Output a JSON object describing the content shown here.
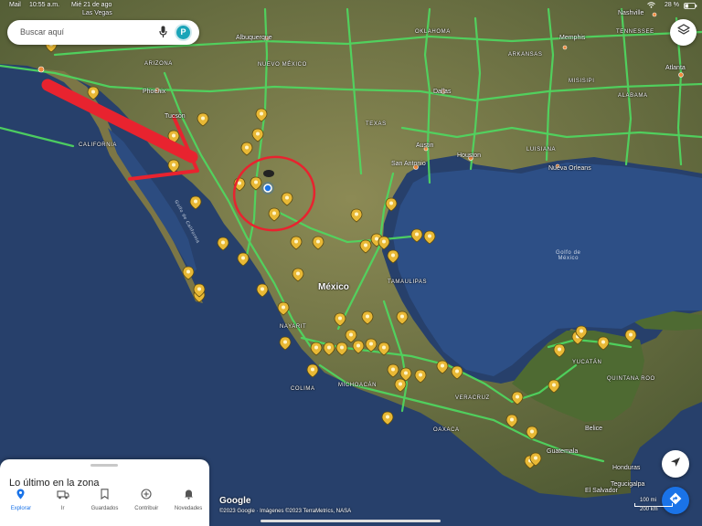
{
  "status_bar": {
    "carrier": "Mail",
    "time": "10:55 a.m.",
    "date": "Mié 21 de ago",
    "battery": "28 %"
  },
  "search": {
    "placeholder": "Buscar aquí",
    "avatar_letter": "P",
    "mic_icon": "microphone-icon"
  },
  "map": {
    "country_label": "México",
    "region_labels": {
      "arizona": "ARIZONA",
      "new_mexico": "NUEVO MÉXICO",
      "texas": "TEXAS",
      "oklahoma": "OKLAHOMA",
      "arkansas": "ARKANSAS",
      "tennessee": "TENNESSEE",
      "alabama": "ALABAMA",
      "misisipi": "MISISIPI",
      "luisiana": "LUISIANA",
      "california": "CALIFORNIA",
      "tamaulipas": "TAMAULIPAS",
      "nayarit": "NAYARIT",
      "colima": "COLIMA",
      "michoacan": "MICHOACÁN",
      "veracruz": "VERACRUZ",
      "oaxaca": "OAXACA",
      "yucatan": "YUCATÁN",
      "quintana_roo": "QUINTANA ROO"
    },
    "city_labels": {
      "las_vegas": "Las Vegas",
      "albuquerque": "Albuquerque",
      "phoenix": "Phoenix",
      "tucson": "Tucsón",
      "dallas": "Dallas",
      "austin": "Austin",
      "san_antonio": "San Antonio",
      "houston": "Houston",
      "nueva_orleans": "Nueva Orleans",
      "memphis": "Memphis",
      "nashville": "Nashville",
      "atlanta": "Atlanta",
      "belice": "Belice",
      "guatemala": "Guatemala",
      "honduras": "Honduras",
      "tegucigalpa": "Tegucigalpa",
      "el_salvador": "El Salvador"
    },
    "water_labels": {
      "gulf": "Golfo de\nMéxico",
      "gulf_california": "Golfo de California"
    },
    "logo": "Google",
    "attribution": "©2023 Google · Imágenes ©2023 TerraMetrics, NASA",
    "scale_mi": "100 mi",
    "scale_km": "200 km",
    "colors": {
      "ocean": "#27406b",
      "land": "#6a6f3c",
      "roads": "#4fd860",
      "pin": "#e8b835",
      "annotation": "#e8232f",
      "accent": "#1a73e8"
    }
  },
  "controls": {
    "layers_icon": "layers-icon",
    "locate_icon": "location-arrow-icon",
    "directions_icon": "directions-icon"
  },
  "panel": {
    "title": "Lo último en la zona"
  },
  "bottom_nav": [
    {
      "label": "Explorar",
      "icon": "pin-icon",
      "active": true
    },
    {
      "label": "Ir",
      "icon": "car-icon",
      "active": false
    },
    {
      "label": "Guardados",
      "icon": "bookmark-icon",
      "active": false
    },
    {
      "label": "Contribuir",
      "icon": "add-circle-icon",
      "active": false
    },
    {
      "label": "Novedades",
      "icon": "bell-icon",
      "active": false
    }
  ]
}
